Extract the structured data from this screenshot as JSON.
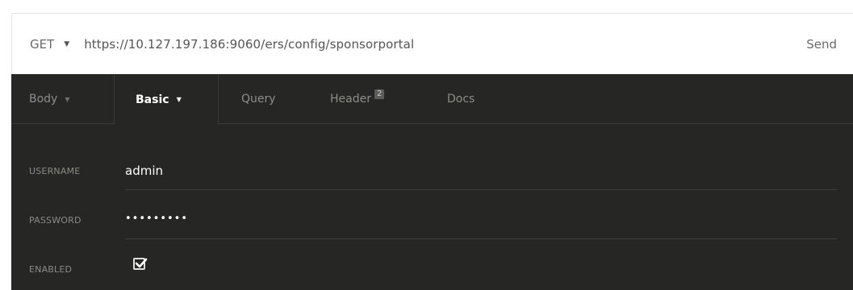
{
  "request": {
    "method": "GET",
    "url": "https://10.127.197.186:9060/ers/config/sponsorportal",
    "send_label": "Send"
  },
  "tabs": {
    "body": "Body",
    "basic": "Basic",
    "query": "Query",
    "header": "Header",
    "header_count": "2",
    "docs": "Docs",
    "active": "Basic"
  },
  "auth": {
    "username_label": "USERNAME",
    "username_value": "admin",
    "password_label": "PASSWORD",
    "password_value": "•••••••••",
    "enabled_label": "ENABLED",
    "enabled": true
  },
  "colors": {
    "panel_bg": "#262624",
    "active_tab_text": "#ffffff",
    "inactive_tab_text": "#8d8d8a"
  }
}
